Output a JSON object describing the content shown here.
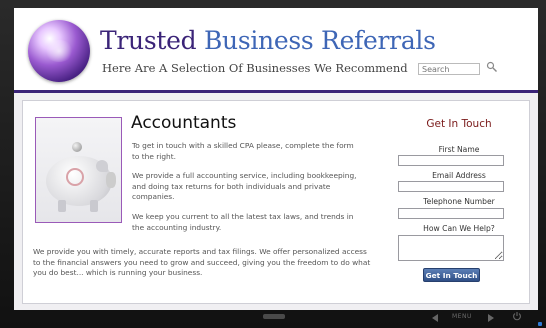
{
  "header": {
    "title_part1": "Trusted ",
    "title_part2": "Business Referrals",
    "tagline": "Here Are A Selection Of Businesses We Recommend",
    "search_placeholder": "Search"
  },
  "main": {
    "heading": "Accountants",
    "paragraphs": [
      "To get in touch with a skilled CPA please, complete the form to the right.",
      "We provide a full accounting service, including bookkeeping, and doing tax returns for both individuals and private companies.",
      "We keep you current to all the latest tax laws, and trends in the accounting industry.",
      "We provide you with timely, accurate reports and tax filings. We offer personalized access to the financial answers you need to grow and succeed, giving you the freedom to do what you do best... which is running your business."
    ]
  },
  "contact_form": {
    "title": "Get In Touch",
    "first_name_label": "First Name",
    "email_label": "Email Address",
    "phone_label": "Telephone Number",
    "help_label": "How Can We Help?",
    "submit_label": "Get In Touch"
  },
  "device": {
    "menu_label": "MENU"
  },
  "icons": [
    "logo-orb-icon",
    "search-icon",
    "piggy-bank-image",
    "nav-left-icon",
    "nav-right-icon",
    "power-icon"
  ],
  "colors": {
    "title_purple": "#3b2478",
    "title_blue": "#3e66b6",
    "form_title": "#7a1a1a",
    "button": "#3a5a94",
    "photo_border": "#9a5ab8"
  }
}
